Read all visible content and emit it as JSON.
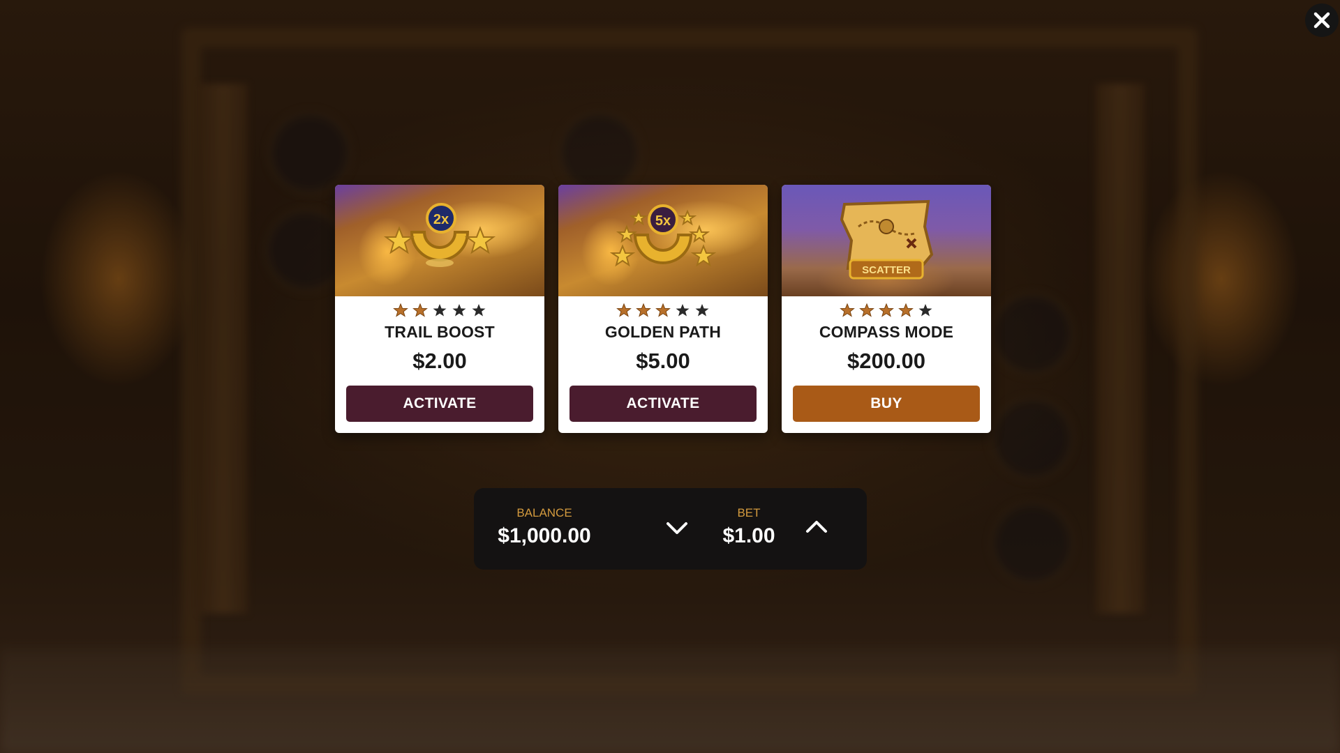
{
  "close_button": {
    "icon": "close-icon"
  },
  "cards": [
    {
      "title": "TRAIL BOOST",
      "price": "$2.00",
      "rating": 2,
      "max_rating": 5,
      "badge": "2x",
      "button_label": "ACTIVATE",
      "button_color": "#4a1c2e",
      "image": "horseshoe-2x-icon"
    },
    {
      "title": "GOLDEN PATH",
      "price": "$5.00",
      "rating": 3,
      "max_rating": 5,
      "badge": "5x",
      "button_label": "ACTIVATE",
      "button_color": "#4a1c2e",
      "image": "horseshoe-5x-icon"
    },
    {
      "title": "COMPASS MODE",
      "price": "$200.00",
      "rating": 4,
      "max_rating": 5,
      "badge": "SCATTER",
      "button_label": "BUY",
      "button_color": "#a95a17",
      "image": "treasure-map-scatter-icon"
    }
  ],
  "bet_bar": {
    "balance_label": "BALANCE",
    "balance_value": "$1,000.00",
    "bet_label": "BET",
    "bet_value": "$1.00",
    "decrease_icon": "chevron-down-icon",
    "increase_icon": "chevron-up-icon"
  },
  "colors": {
    "star_filled": "#b8702a",
    "star_empty": "#2a2a2a",
    "label_accent": "#d39a3e"
  }
}
